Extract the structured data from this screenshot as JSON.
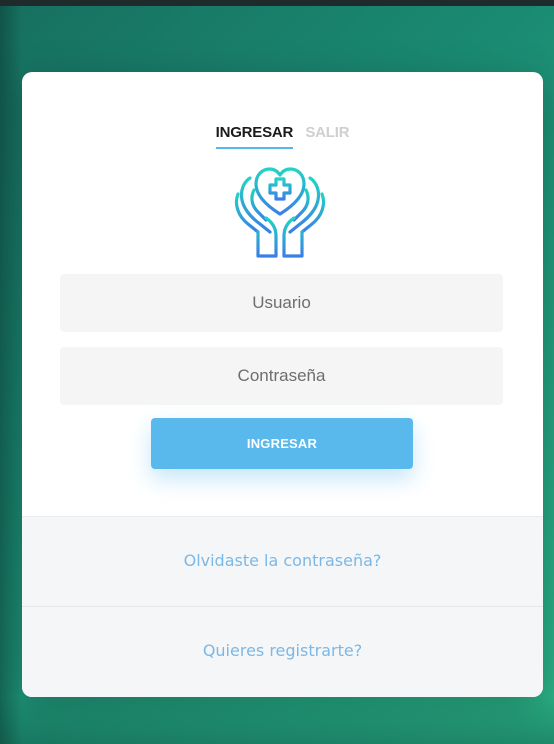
{
  "tabs": {
    "login_label": "INGRESAR",
    "logout_label": "SALIR"
  },
  "logo": {
    "icon": "hands-heart-cross-icon"
  },
  "form": {
    "username_placeholder": "Usuario",
    "password_placeholder": "Contraseña",
    "submit_label": "INGRESAR"
  },
  "footer": {
    "forgot_label": "Olvidaste la contraseña?",
    "register_label": "Quieres registrarte?"
  },
  "colors": {
    "accent": "#59b8ec",
    "link": "#7cb8e6",
    "background_start": "#176f60",
    "background_end": "#2bb487"
  }
}
